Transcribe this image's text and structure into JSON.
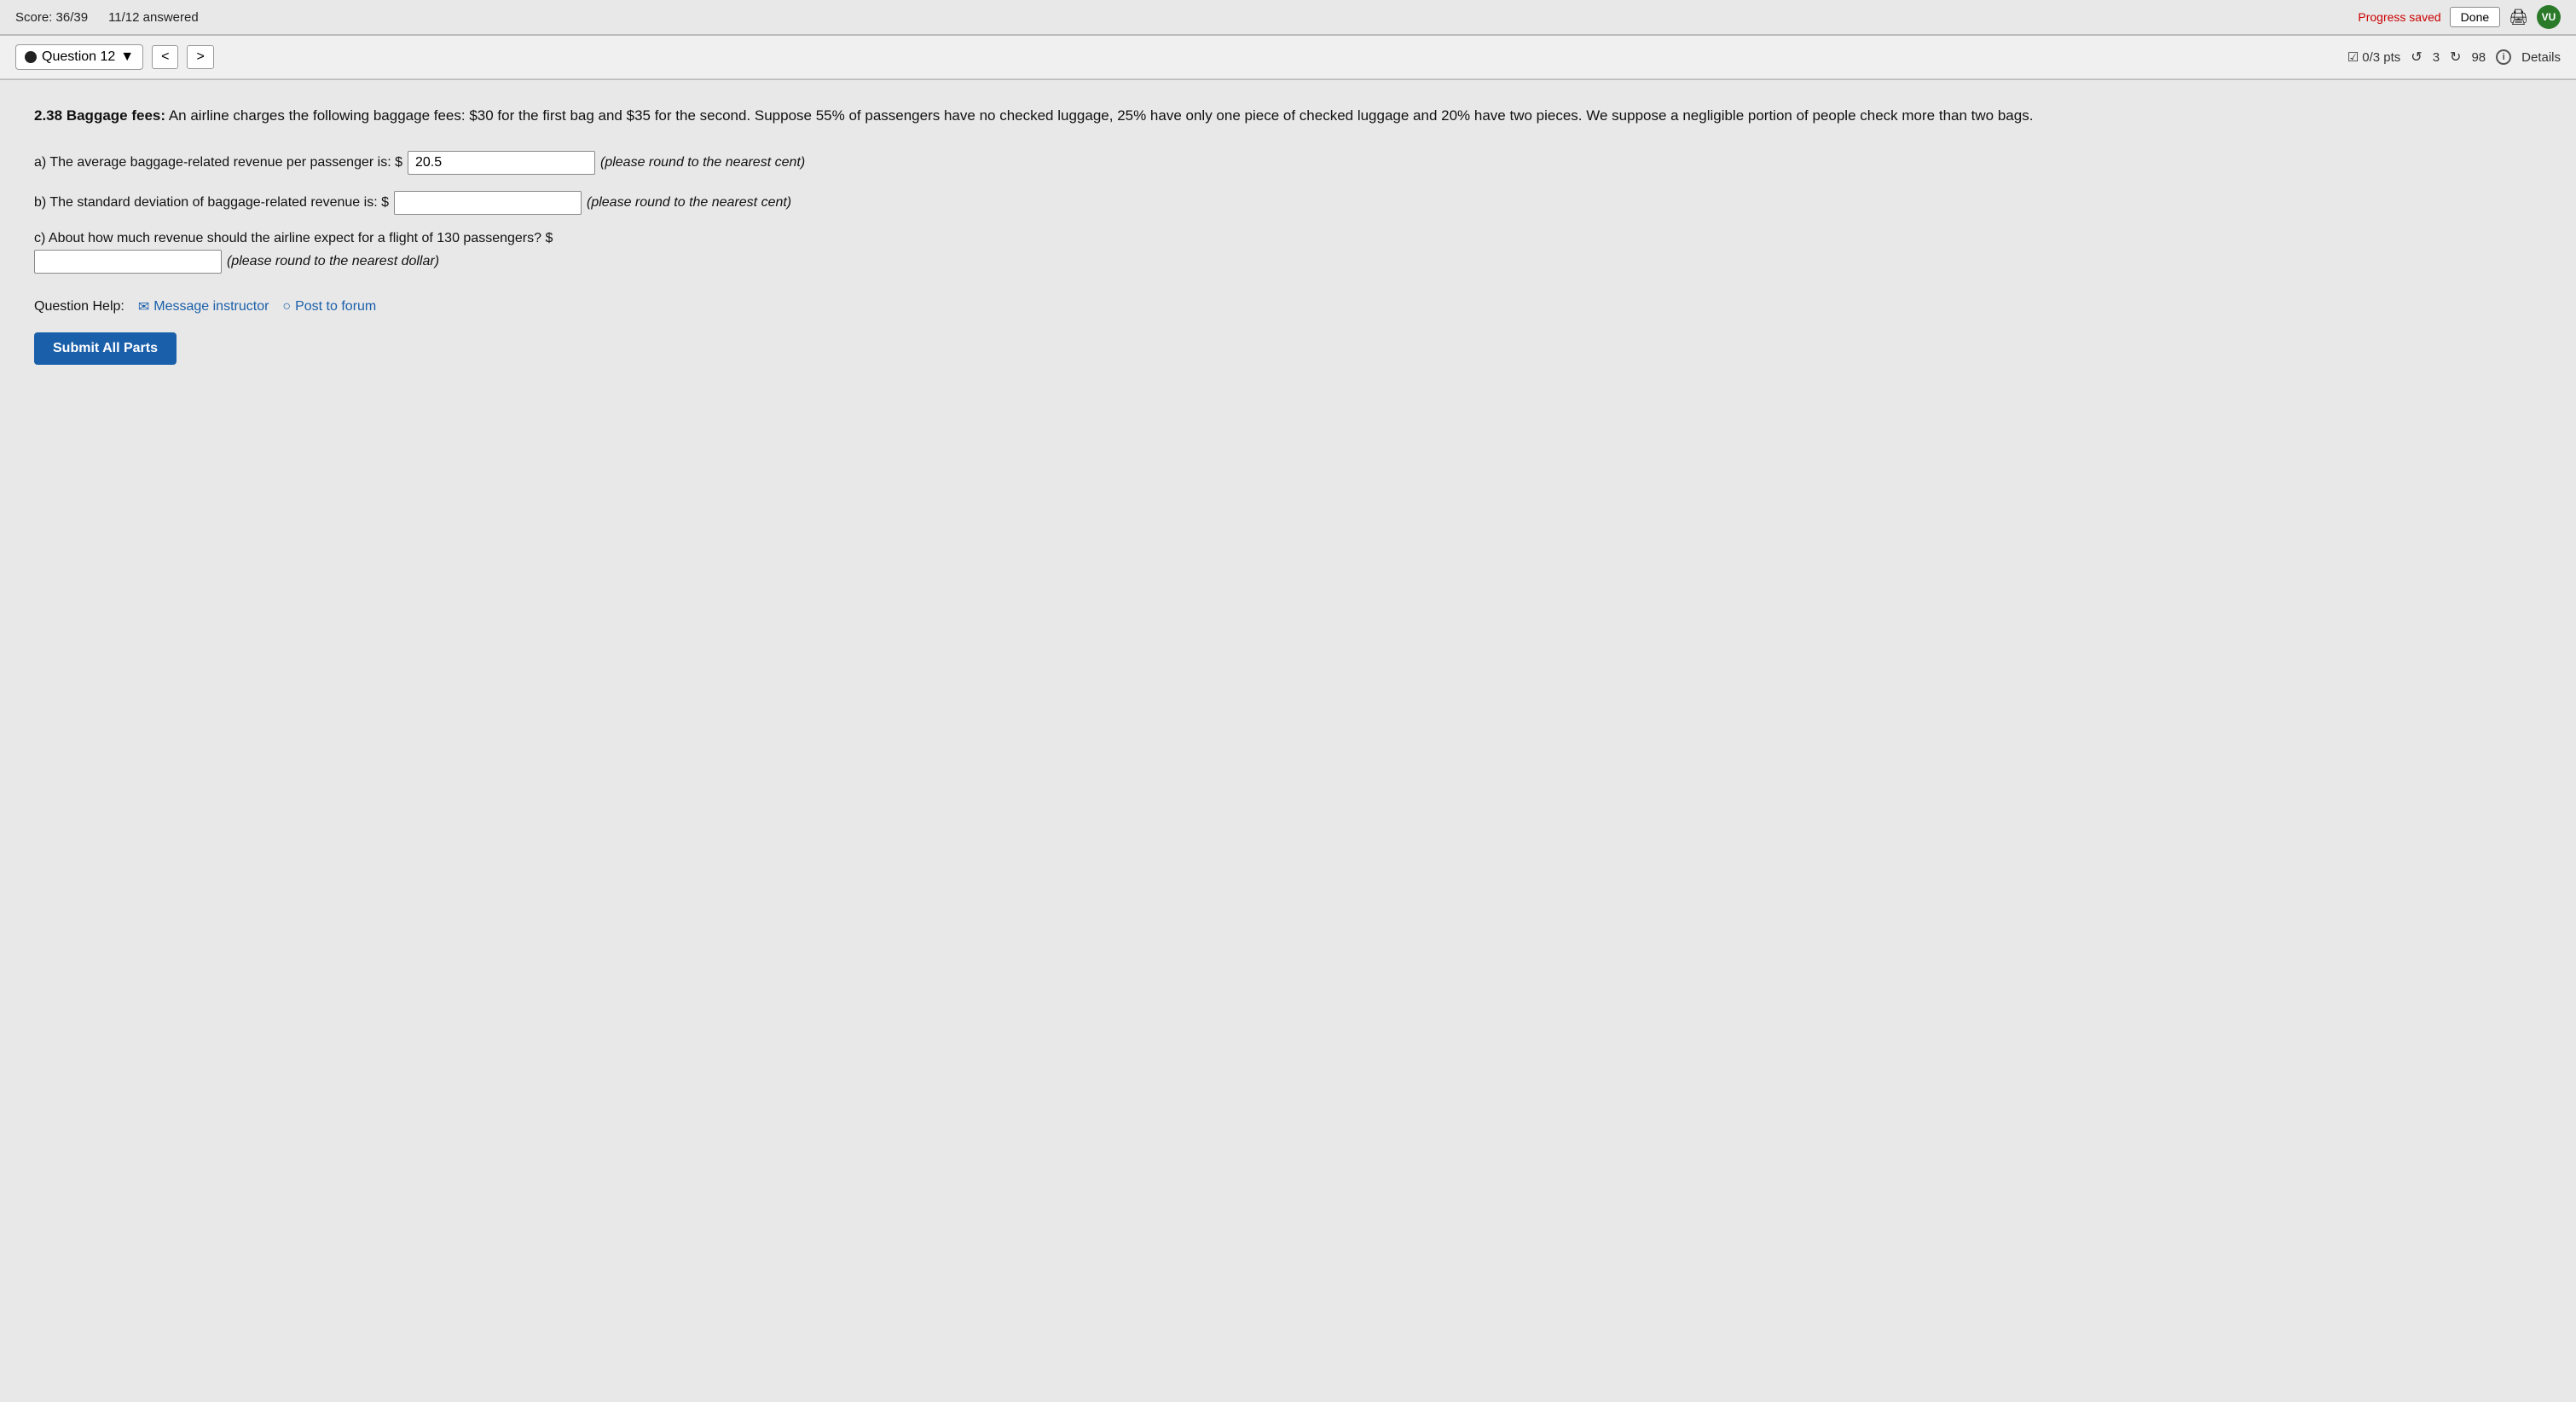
{
  "topbar": {
    "score_label": "Score: 36/39",
    "answered_label": "11/12 answered",
    "progress_saved": "Progress saved",
    "done_label": "Done",
    "avatar_initials": "VU"
  },
  "question_nav": {
    "question_label": "Question 12",
    "prev_arrow": "<",
    "next_arrow": ">",
    "pts_label": "0/3 pts",
    "retry_count": "3",
    "attempt_count": "98",
    "details_label": "Details"
  },
  "question": {
    "problem_id": "2.38",
    "problem_title": "Baggage fees:",
    "problem_text": " An airline charges the following baggage fees: $30 for the first bag and $35 for the second. Suppose 55% of passengers have no checked luggage, 25% have only one piece of checked luggage and 20% have two pieces. We suppose a negligible portion of people check more than two bags.",
    "part_a_prefix": "a) The average baggage-related revenue per passenger is: $",
    "part_a_value": "20.5",
    "part_a_suffix": "(please round to the nearest cent)",
    "part_b_prefix": "b) The standard deviation of baggage-related revenue is: $",
    "part_b_value": "",
    "part_b_suffix": "(please round to the nearest cent)",
    "part_c_prefix": "c) About how much revenue should the airline expect for a flight of 130 passengers? $",
    "part_c_value": "",
    "part_c_suffix": "(please round to the nearest dollar)",
    "help_label": "Question Help:",
    "message_instructor_label": "Message instructor",
    "post_to_forum_label": "Post to forum",
    "submit_label": "Submit All Parts"
  }
}
